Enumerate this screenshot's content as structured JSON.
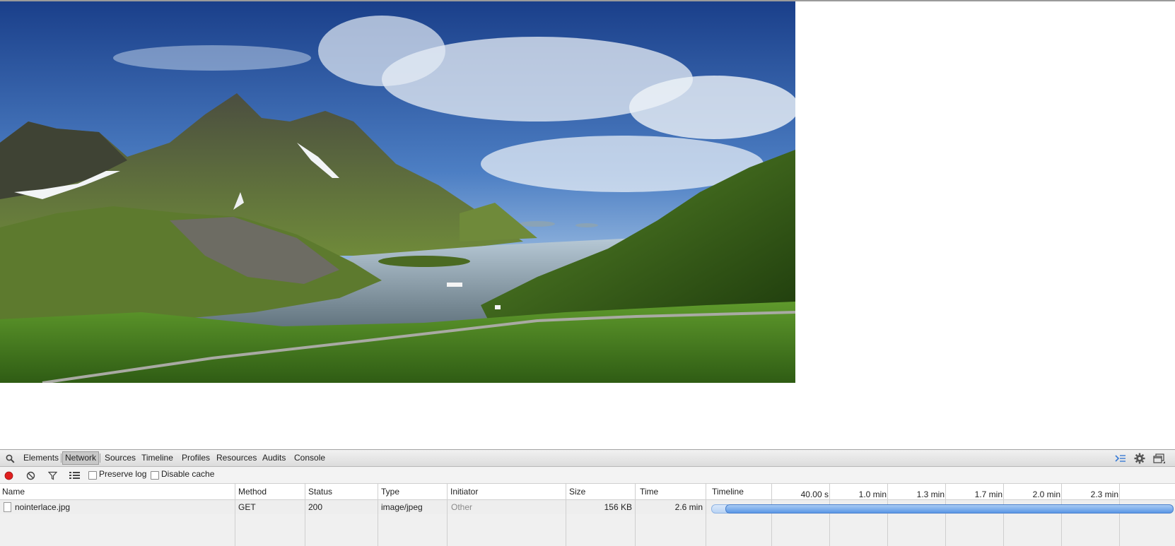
{
  "devtools": {
    "tabs": [
      "Elements",
      "Network",
      "Sources",
      "Timeline",
      "Profiles",
      "Resources",
      "Audits",
      "Console"
    ],
    "selected_tab": "Network",
    "toolbar": {
      "preserve_log_label": "Preserve log",
      "disable_cache_label": "Disable cache"
    },
    "columns": {
      "name": "Name",
      "method": "Method",
      "status": "Status",
      "type": "Type",
      "initiator": "Initiator",
      "size": "Size",
      "time": "Time",
      "timeline": "Timeline"
    },
    "timeline_ticks": [
      "40.00 s",
      "1.0 min",
      "1.3 min",
      "1.7 min",
      "2.0 min",
      "2.3 min"
    ],
    "requests": [
      {
        "name": "nointerlace.jpg",
        "method": "GET",
        "status": "200",
        "type": "image/jpeg",
        "initiator": "Other",
        "size": "156 KB",
        "time": "2.6 min"
      }
    ],
    "icons": {
      "search": "search-icon",
      "record": "record-icon",
      "clear": "clear-icon",
      "filter": "filter-icon",
      "view": "list-view-icon",
      "console_drawer": "console-drawer-icon",
      "settings": "gear-icon",
      "dock": "dock-icon"
    },
    "colors": {
      "record": "#e02020",
      "timeline_bar": "#5a97e6"
    }
  }
}
